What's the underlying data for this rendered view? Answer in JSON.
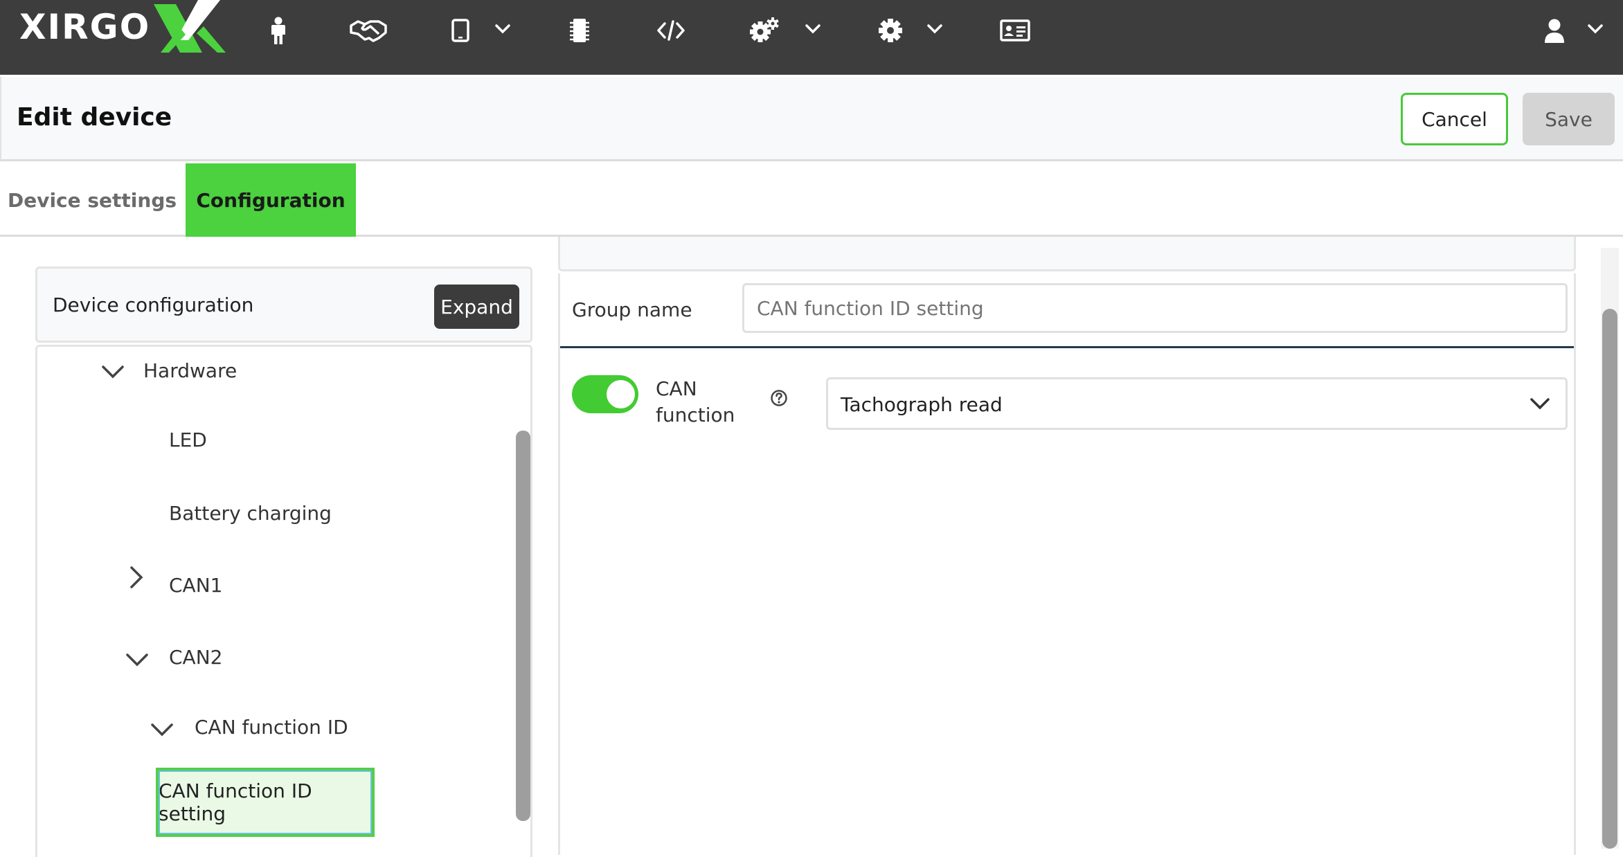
{
  "brand": {
    "logo_text": "XIRGO",
    "accent": "#4bd23e"
  },
  "topnav": {
    "icons": [
      "person-icon",
      "handshake-icon",
      "tablet-icon",
      "chip-icon",
      "code-icon",
      "gears-icon",
      "gear-icon",
      "id-card-icon",
      "user-icon"
    ]
  },
  "header": {
    "title": "Edit device",
    "cancel_label": "Cancel",
    "save_label": "Save"
  },
  "tabs": [
    {
      "label": "Device settings",
      "active": false
    },
    {
      "label": "Configuration",
      "active": true
    }
  ],
  "config_panel": {
    "title": "Device configuration",
    "expand_label": "Expand",
    "tree": [
      {
        "label": "Hardware",
        "expanded": true
      },
      {
        "label": "LED"
      },
      {
        "label": "Battery charging"
      },
      {
        "label": "CAN1",
        "expanded": false
      },
      {
        "label": "CAN2",
        "expanded": true
      },
      {
        "label": "CAN function ID",
        "expanded": true
      },
      {
        "label": "CAN function ID setting",
        "selected": true
      }
    ]
  },
  "detail": {
    "group_name_label": "Group name",
    "group_name_placeholder": "CAN function ID setting",
    "can_function_label_1": "CAN",
    "can_function_label_2": "function",
    "can_function_enabled": true,
    "can_function_value": "Tachograph read"
  }
}
